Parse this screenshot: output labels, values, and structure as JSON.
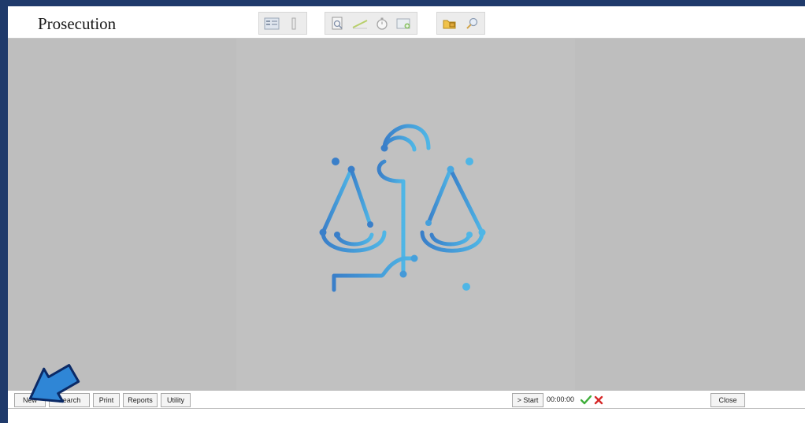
{
  "window": {
    "title": "Prosecution"
  },
  "toolbar": {
    "groups": [
      {
        "icons": [
          "list-view-icon",
          "bookmark-icon"
        ]
      },
      {
        "icons": [
          "document-search-icon",
          "edit-line-icon",
          "timer-icon",
          "image-add-icon"
        ]
      },
      {
        "icons": [
          "folder-lock-icon",
          "search-key-icon"
        ]
      }
    ]
  },
  "logo": {
    "icon": "scales-of-justice-icon",
    "gradient": [
      "#3a7fc9",
      "#4fb6e6"
    ]
  },
  "bottom_bar": {
    "buttons": {
      "new": "New",
      "search": "Search",
      "print": "Print",
      "reports": "Reports",
      "utility": "Utility",
      "start": "> Start",
      "close": "Close"
    },
    "timer": "00:00:00",
    "ok_icon": "green-check-icon",
    "cancel_icon": "red-x-icon"
  },
  "annotation": {
    "icon": "blue-arrow-pointer-icon",
    "color": "#2f86d6"
  }
}
